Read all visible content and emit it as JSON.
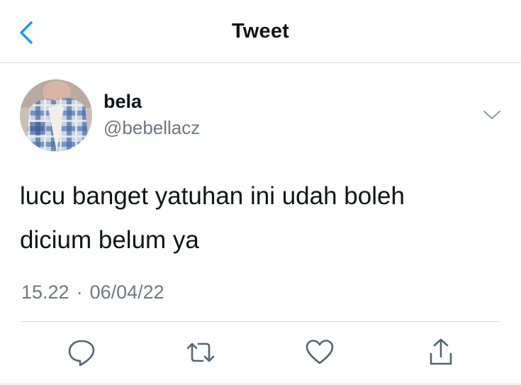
{
  "header": {
    "title": "Tweet",
    "back_icon": "chevron-left-icon"
  },
  "author": {
    "display_name": "bela",
    "handle": "@bebellacz",
    "avatar": "profile-photo-plaid-jacket"
  },
  "tweet": {
    "text_lines": [
      "lucu banget yatuhan ini udah boleh",
      "dicium belum ya"
    ],
    "time": "15.22",
    "separator": "·",
    "date": "06/04/22"
  },
  "actions": [
    {
      "icon": "reply-icon"
    },
    {
      "icon": "retweet-icon"
    },
    {
      "icon": "like-icon"
    },
    {
      "icon": "share-icon"
    }
  ],
  "colors": {
    "accent": "#1d9bf0",
    "text": "#0f1419",
    "secondary": "#6e7781",
    "border": "#d6d9dc"
  }
}
